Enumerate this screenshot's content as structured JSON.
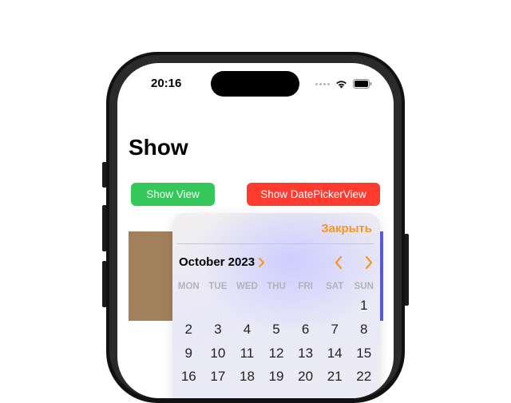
{
  "status_bar": {
    "time": "20:16"
  },
  "page": {
    "title": "Show"
  },
  "buttons": {
    "show_view": "Show View",
    "show_picker": "Show DatePickerView"
  },
  "picker": {
    "close_label": "Закрыть",
    "month_label": "October 2023",
    "weekdays": [
      "MON",
      "TUE",
      "WED",
      "THU",
      "FRI",
      "SAT",
      "SUN"
    ],
    "weeks": [
      [
        "",
        "",
        "",
        "",
        "",
        "",
        "1"
      ],
      [
        "2",
        "3",
        "4",
        "5",
        "6",
        "7",
        "8"
      ],
      [
        "9",
        "10",
        "11",
        "12",
        "13",
        "14",
        "15"
      ],
      [
        "16",
        "17",
        "18",
        "19",
        "20",
        "21",
        "22"
      ]
    ]
  },
  "colors": {
    "accent": "#f7971e",
    "green": "#34c759",
    "red": "#ff3b30",
    "brown": "#a2805c",
    "purple": "#5e5ce6"
  }
}
